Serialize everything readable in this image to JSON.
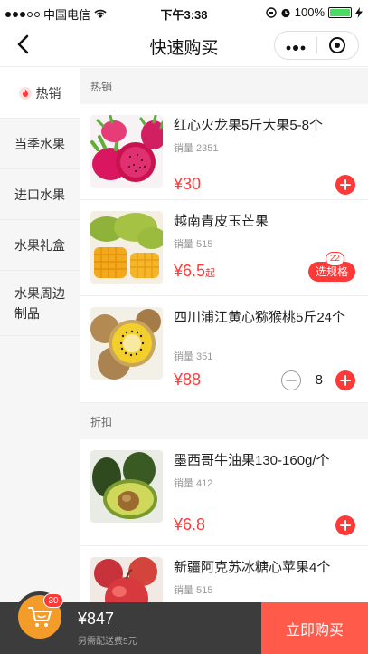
{
  "status_bar": {
    "carrier": "中国电信",
    "time": "下午3:38",
    "battery": "100%",
    "battery_level": 1.0
  },
  "nav": {
    "title": "快速购买"
  },
  "sidebar": {
    "items": [
      {
        "label": "热销",
        "active": true
      },
      {
        "label": "当季水果"
      },
      {
        "label": "进口水果"
      },
      {
        "label": "水果礼盒"
      },
      {
        "label": "水果周边",
        "label2": "制品"
      }
    ]
  },
  "sections": {
    "hot": "热销",
    "discount": "折扣"
  },
  "products": [
    {
      "name": "红心火龙果5斤大果5-8个",
      "sales": "销量 2351",
      "price": "¥30",
      "action": "add"
    },
    {
      "name": "越南青皮玉芒果",
      "sales": "销量 515",
      "price": "¥6.5",
      "price_suffix": "起",
      "action": "spec",
      "spec_label": "选规格",
      "spec_count": "22"
    },
    {
      "name": "四川浦江黄心猕猴桃5斤24个",
      "sales": "销量 351",
      "price": "¥88",
      "action": "qty",
      "qty": "8"
    },
    {
      "name": "墨西哥牛油果130-160g/个",
      "sales": "销量 412",
      "price": "¥6.8",
      "action": "add"
    },
    {
      "name": "新疆阿克苏冰糖心苹果4个",
      "sales": "销量 515",
      "price": "",
      "action": "none"
    }
  ],
  "cart": {
    "badge": "30",
    "total": "¥847",
    "note": "另需配送费5元",
    "buy_label": "立即购买"
  },
  "colors": {
    "accent": "#ff3838",
    "cart_bar": "#3c3c3c",
    "cart_icon": "#f39c2a",
    "buy_button": "#ff5a4a"
  }
}
